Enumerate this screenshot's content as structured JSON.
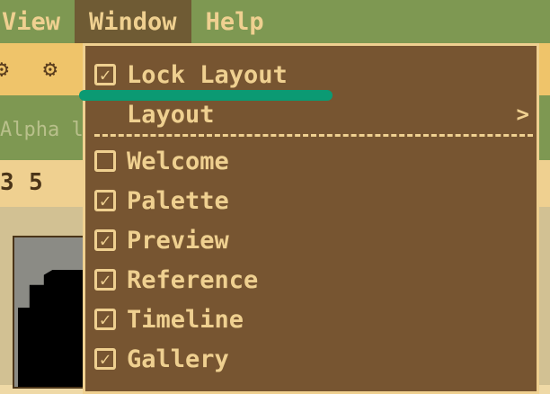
{
  "menubar": {
    "items": [
      {
        "label": "View"
      },
      {
        "label": "Window"
      },
      {
        "label": "Help"
      }
    ]
  },
  "toolbar": {
    "icons": [
      "gear-icon",
      "gear-icon"
    ]
  },
  "optionbar": {
    "alpha_label": "Alpha l"
  },
  "numbar": {
    "values": [
      "3",
      "5"
    ]
  },
  "window_menu": {
    "items": [
      {
        "label": "Lock Layout",
        "checked": true
      },
      {
        "label": "Layout",
        "submenu_arrow": ">"
      },
      {
        "label": "Welcome",
        "checked": false
      },
      {
        "label": "Palette",
        "checked": true
      },
      {
        "label": "Preview",
        "checked": true
      },
      {
        "label": "Reference",
        "checked": true
      },
      {
        "label": "Timeline",
        "checked": true
      },
      {
        "label": "Gallery",
        "checked": true
      }
    ]
  },
  "colors": {
    "menubar": "#7e9852",
    "menu_bg": "#775531",
    "menu_text": "#efd090",
    "toolbar": "#efc46a",
    "highlight": "#0b9a73"
  }
}
